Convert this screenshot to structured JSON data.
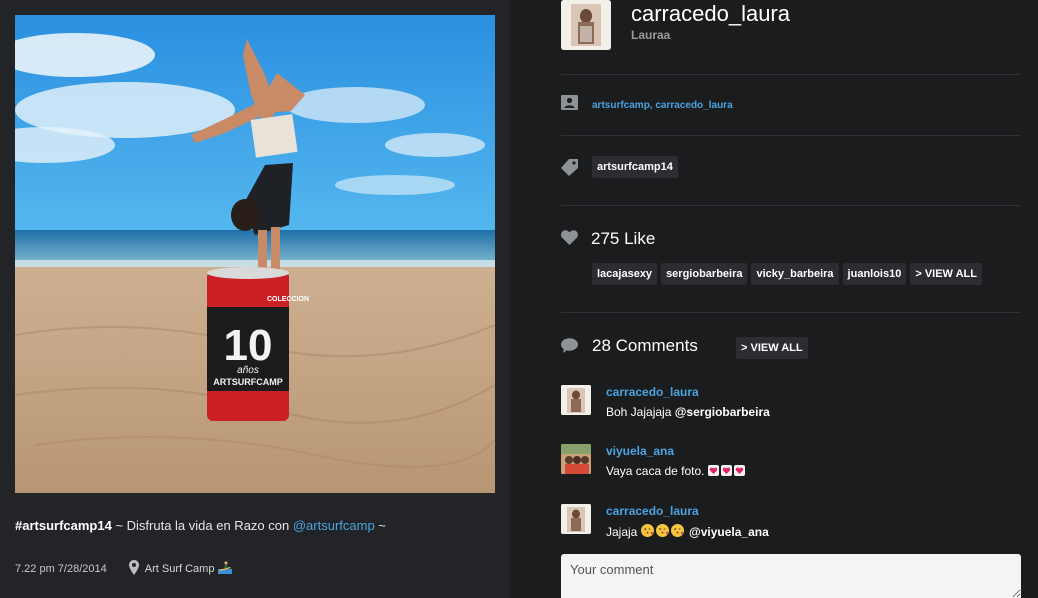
{
  "post": {
    "caption_hashtag": "#artsurfcamp14",
    "caption_text": " ~ Disfruta la vida en Razo con ",
    "caption_mention": "@artsurfcamp",
    "caption_end": " ~",
    "timestamp": "7.22 pm 7/28/2014",
    "location": "Art Surf Camp",
    "can_label_top": "COLECCION",
    "can_label_number": "10",
    "can_label_years": "años",
    "can_label_brand": "ARTSURFCAMP"
  },
  "author": {
    "username": "carracedo_laura",
    "full_name": "Lauraa"
  },
  "tagged_users": "artsurfcamp,  carracedo_laura",
  "hashtags": [
    "artsurfcamp14"
  ],
  "likes": {
    "title": "275 Like",
    "likers": [
      "lacajasexy",
      "sergiobarbeira",
      "vicky_barbeira",
      "juanlois10"
    ],
    "view_all": "> VIEW ALL"
  },
  "comments": {
    "title": "28 Comments",
    "view_all": "> VIEW ALL",
    "items": [
      {
        "user": "carracedo_laura",
        "text": "Boh Jajajaja ",
        "mention": "@sergiobarbeira"
      },
      {
        "user": "viyuela_ana",
        "text": "Vaya caca de foto. ",
        "mention": ""
      },
      {
        "user": "carracedo_laura",
        "text": "Jajaja ",
        "mention": "@viyuela_ana"
      }
    ]
  },
  "comment_input": {
    "placeholder": "Your comment"
  },
  "colors": {
    "accent": "#4aa3df",
    "background": "#1b1c1e",
    "chip": "#2b2d30"
  }
}
